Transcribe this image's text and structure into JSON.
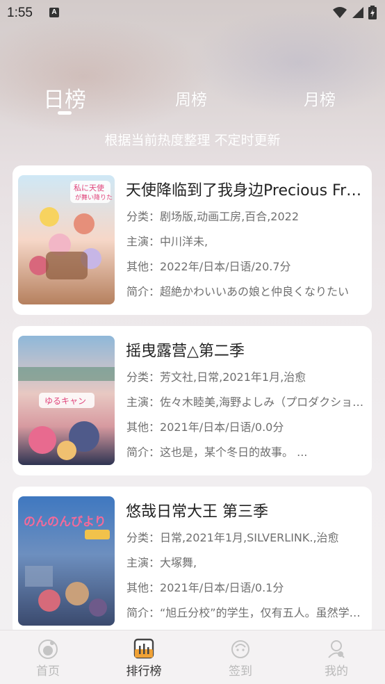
{
  "status_bar": {
    "time": "1:55",
    "notification_badge": "A"
  },
  "tabs": [
    {
      "label": "日榜",
      "active": true
    },
    {
      "label": "周榜",
      "active": false
    },
    {
      "label": "月榜",
      "active": false
    }
  ],
  "subtitle": "根据当前热度整理 不定时更新",
  "items": [
    {
      "title": "天使降临到了我身边Precious Friends",
      "category_label": "分类：",
      "category": "剧场版,动画工房,百合,2022",
      "cast_label": "主演：",
      "cast": "中川洋未,",
      "other_label": "其他：",
      "other": "2022年/日本/日语/20.7分",
      "intro_label": "简介：",
      "intro": "超絶かわいいあの娘と仲良くなりたい",
      "poster_colors": [
        "#f4d9c8",
        "#e58fa6",
        "#7fb4d8"
      ]
    },
    {
      "title": "摇曳露营△第二季",
      "category_label": "分类：",
      "category": "芳文社,日常,2021年1月,治愈",
      "cast_label": "主演：",
      "cast": "佐々木睦美,海野よしみ（プロダクション）",
      "other_label": "其他：",
      "other": "2021年/日本/日语/0.0分",
      "intro_label": "简介：",
      "intro": "这也是，某个冬日的故事。 ...",
      "poster_colors": [
        "#7aa7c9",
        "#d9a7a0",
        "#3d4a6a"
      ]
    },
    {
      "title": "悠哉日常大王 第三季",
      "category_label": "分类：",
      "category": "日常,2021年1月,SILVERLINK.,治愈",
      "cast_label": "主演：",
      "cast": "大塚舞,",
      "other_label": "其他：",
      "other": "2021年/日本/日语/0.1分",
      "intro_label": "简介：",
      "intro": "“旭丘分校”的学生，仅有五人。虽然学年不同",
      "poster_colors": [
        "#4f7fbf",
        "#e64e7a",
        "#f1c24b"
      ]
    }
  ],
  "bottom_nav": [
    {
      "label": "首页",
      "icon": "home-icon",
      "active": false
    },
    {
      "label": "排行榜",
      "icon": "ranking-icon",
      "active": true
    },
    {
      "label": "签到",
      "icon": "checkin-icon",
      "active": false
    },
    {
      "label": "我的",
      "icon": "profile-icon",
      "active": false
    }
  ],
  "colors": {
    "active_nav_accent": "#f0a236",
    "inactive_nav": "#b9b9b9",
    "card_bg": "#ffffff",
    "muted_text": "#6f6f6f"
  }
}
